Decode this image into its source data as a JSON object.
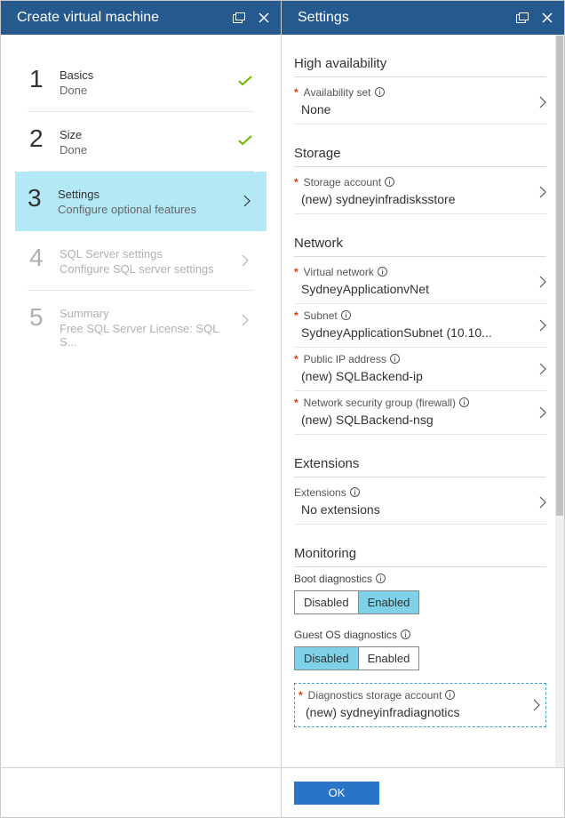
{
  "leftPanel": {
    "title": "Create virtual machine",
    "steps": [
      {
        "num": "1",
        "title": "Basics",
        "sub": "Done",
        "state": "done"
      },
      {
        "num": "2",
        "title": "Size",
        "sub": "Done",
        "state": "done"
      },
      {
        "num": "3",
        "title": "Settings",
        "sub": "Configure optional features",
        "state": "active"
      },
      {
        "num": "4",
        "title": "SQL Server settings",
        "sub": "Configure SQL server settings",
        "state": "disabled"
      },
      {
        "num": "5",
        "title": "Summary",
        "sub": "Free SQL Server License: SQL S...",
        "state": "disabled"
      }
    ]
  },
  "rightPanel": {
    "title": "Settings",
    "sections": {
      "ha": {
        "title": "High availability",
        "availSet": {
          "label": "Availability set",
          "value": "None",
          "required": true
        }
      },
      "storage": {
        "title": "Storage",
        "account": {
          "label": "Storage account",
          "value": "(new) sydneyinfradisksstore",
          "required": true
        }
      },
      "network": {
        "title": "Network",
        "vnet": {
          "label": "Virtual network",
          "value": "SydneyApplicationvNet",
          "required": true
        },
        "subnet": {
          "label": "Subnet",
          "value": "SydneyApplicationSubnet (10.10...",
          "required": true
        },
        "pip": {
          "label": "Public IP address",
          "value": "(new) SQLBackend-ip",
          "required": true
        },
        "nsg": {
          "label": "Network security group (firewall)",
          "value": "(new) SQLBackend-nsg",
          "required": true
        }
      },
      "extensions": {
        "title": "Extensions",
        "ext": {
          "label": "Extensions",
          "value": "No extensions"
        }
      },
      "monitoring": {
        "title": "Monitoring",
        "boot": {
          "label": "Boot diagnostics",
          "options": [
            "Disabled",
            "Enabled"
          ],
          "selected": "Enabled"
        },
        "guest": {
          "label": "Guest OS diagnostics",
          "options": [
            "Disabled",
            "Enabled"
          ],
          "selected": "Disabled"
        },
        "diagStorage": {
          "label": "Diagnostics storage account",
          "value": "(new) sydneyinfradiagnotics",
          "required": true
        }
      }
    },
    "okLabel": "OK"
  }
}
